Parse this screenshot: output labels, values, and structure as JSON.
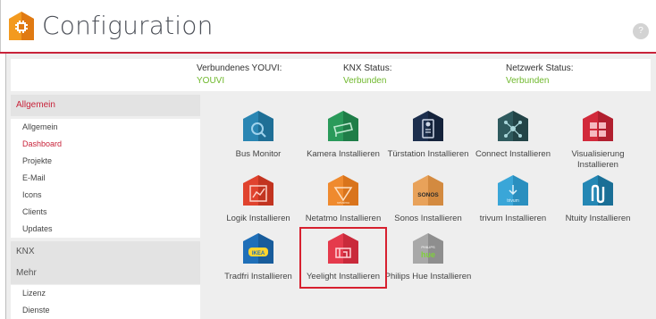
{
  "header": {
    "title": "Configuration",
    "help_icon": "question-icon",
    "accent": "#c8233a"
  },
  "status": {
    "youvi": {
      "label": "Verbundenes YOUVI:",
      "value": "YOUVI"
    },
    "knx": {
      "label": "KNX Status:",
      "value": "Verbunden"
    },
    "network": {
      "label": "Netzwerk Status:",
      "value": "Verbunden"
    }
  },
  "sidebar": {
    "allgemein": {
      "title": "Allgemein",
      "items": [
        "Allgemein",
        "Dashboard",
        "Projekte",
        "E-Mail",
        "Icons",
        "Clients",
        "Updates"
      ],
      "active": "Dashboard"
    },
    "knx_title": "KNX",
    "mehr": {
      "title": "Mehr",
      "items": [
        "Lizenz",
        "Dienste"
      ]
    }
  },
  "tiles": [
    {
      "label": "Bus Monitor",
      "icon": "bus-monitor-icon",
      "color": "#2a86b3"
    },
    {
      "label": "Kamera Installieren",
      "icon": "camera-icon",
      "color": "#2a9a5a"
    },
    {
      "label": "Türstation Installieren",
      "icon": "door-station-icon",
      "color": "#1d2f4e"
    },
    {
      "label": "Connect Installieren",
      "icon": "connect-icon",
      "color": "#2f5a5e"
    },
    {
      "label": "Visualisierung Installieren",
      "icon": "visualization-icon",
      "color": "#d22a3b"
    },
    {
      "label": "Logik Installieren",
      "icon": "logic-icon",
      "color": "#e0432e"
    },
    {
      "label": "Netatmo Installieren",
      "icon": "netatmo-icon",
      "color": "#ef8a2e",
      "badge": "netatmo"
    },
    {
      "label": "Sonos Installieren",
      "icon": "sonos-icon",
      "color": "#e8a25a",
      "badge": "SONOS"
    },
    {
      "label": "trivum Installieren",
      "icon": "trivum-icon",
      "color": "#3aa6d8",
      "badge": "trivum"
    },
    {
      "label": "Ntuity Installieren",
      "icon": "ntuity-icon",
      "color": "#2487b4",
      "badge": "ɳ"
    },
    {
      "label": "Tradfri Installieren",
      "icon": "ikea-icon",
      "color": "#1f6fb8",
      "badge": "IKEA"
    },
    {
      "label": "Yeelight Installieren",
      "icon": "yeelight-icon",
      "color": "#e53a4c"
    },
    {
      "label": "Philips Hue Installieren",
      "icon": "philips-hue-icon",
      "color": "#9a9a9a",
      "badge": "PHILIPS hue"
    }
  ],
  "highlighted_tile": "Yeelight Installieren"
}
